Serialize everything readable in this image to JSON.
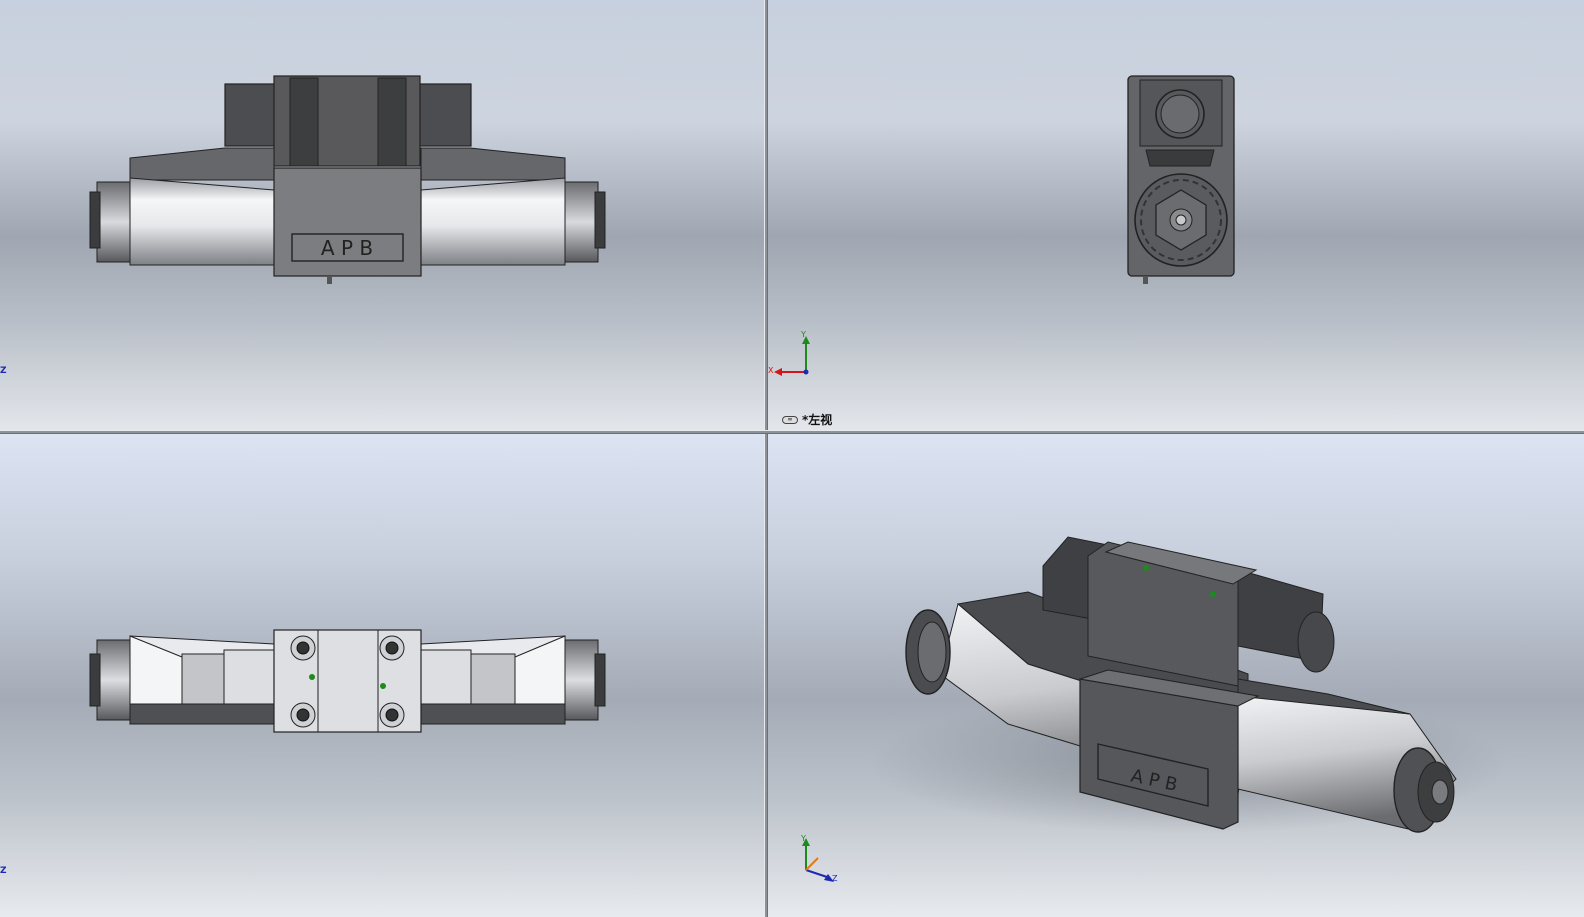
{
  "part_label": "A P B",
  "viewports": {
    "top_right": {
      "view_name": "*左视",
      "camera_icon": "∞"
    },
    "top_left": {
      "axis_partial": "Z"
    },
    "bottom_left": {
      "axis_partial": "Z"
    }
  },
  "axes": {
    "x": "X",
    "y": "Y",
    "z": "Z"
  },
  "colors": {
    "body_dark": "#4a4b4d",
    "body_mid": "#6e7073",
    "coil_light": "#e9ebee",
    "x_axis": "#d01616",
    "y_axis": "#1c8a1c",
    "z_axis": "#1b2ab0"
  }
}
